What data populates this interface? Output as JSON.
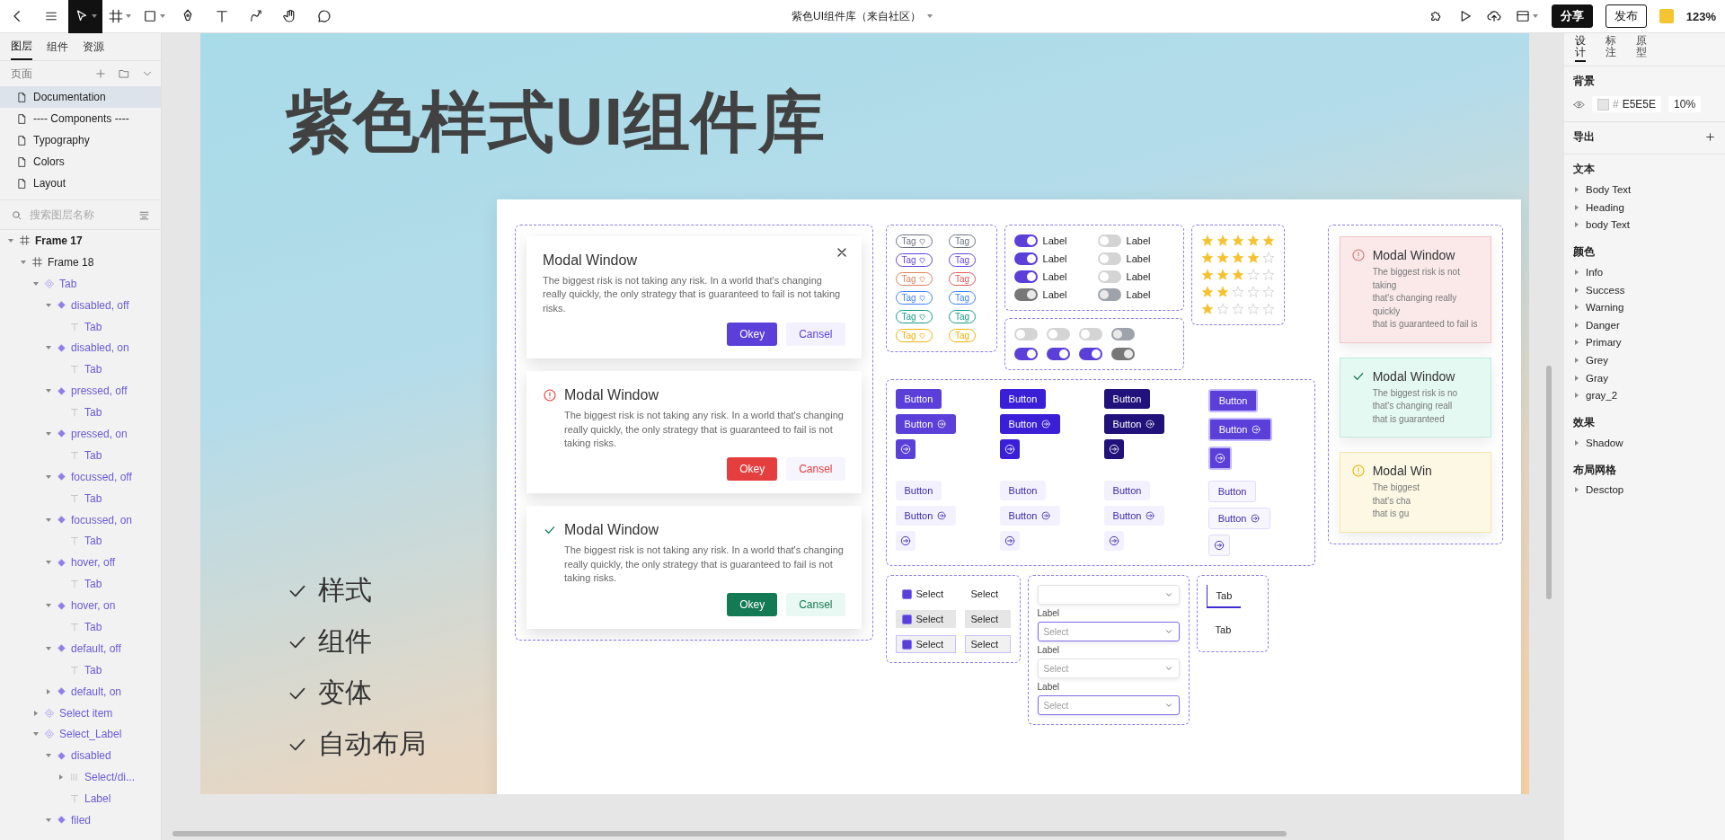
{
  "toolbar": {
    "title": "紫色UI组件库（来自社区）",
    "share": "分享",
    "publish": "发布",
    "zoom": "123%"
  },
  "left_panel": {
    "tabs": [
      {
        "label": "图层",
        "selected": true
      },
      {
        "label": "组件",
        "selected": false
      },
      {
        "label": "资源",
        "selected": false
      }
    ],
    "pages_label": "页面",
    "pages": [
      {
        "name": "Documentation",
        "selected": true
      },
      {
        "name": "---- Components ----",
        "selected": false
      },
      {
        "name": "Typography",
        "selected": false
      },
      {
        "name": "Colors",
        "selected": false
      },
      {
        "name": "Layout",
        "selected": false
      }
    ],
    "search": {
      "placeholder": "搜索图层名称"
    },
    "layers": [
      {
        "name": "Frame 17",
        "kind": "frame",
        "expanded": true,
        "children": [
          {
            "name": "Frame 18",
            "kind": "frame",
            "expanded": true,
            "children": [
              {
                "name": "Tab",
                "kind": "component",
                "expanded": true,
                "children": [
                  {
                    "name": "disabled, off",
                    "kind": "variant",
                    "expanded": true,
                    "children": [
                      {
                        "name": "Tab",
                        "kind": "text"
                      }
                    ]
                  },
                  {
                    "name": "disabled, on",
                    "kind": "variant",
                    "expanded": true,
                    "children": [
                      {
                        "name": "Tab",
                        "kind": "text"
                      }
                    ]
                  },
                  {
                    "name": "pressed, off",
                    "kind": "variant",
                    "expanded": true,
                    "children": [
                      {
                        "name": "Tab",
                        "kind": "text"
                      }
                    ]
                  },
                  {
                    "name": "pressed, on",
                    "kind": "variant",
                    "expanded": true,
                    "children": [
                      {
                        "name": "Tab",
                        "kind": "text"
                      }
                    ]
                  },
                  {
                    "name": "focussed, off",
                    "kind": "variant",
                    "expanded": true,
                    "children": [
                      {
                        "name": "Tab",
                        "kind": "text"
                      }
                    ]
                  },
                  {
                    "name": "focussed, on",
                    "kind": "variant",
                    "expanded": true,
                    "children": [
                      {
                        "name": "Tab",
                        "kind": "text"
                      }
                    ]
                  },
                  {
                    "name": "hover, off",
                    "kind": "variant",
                    "expanded": true,
                    "children": [
                      {
                        "name": "Tab",
                        "kind": "text"
                      }
                    ]
                  },
                  {
                    "name": "hover, on",
                    "kind": "variant",
                    "expanded": true,
                    "children": [
                      {
                        "name": "Tab",
                        "kind": "text"
                      }
                    ]
                  },
                  {
                    "name": "default, off",
                    "kind": "variant",
                    "expanded": true,
                    "children": [
                      {
                        "name": "Tab",
                        "kind": "text"
                      }
                    ]
                  },
                  {
                    "name": "default, on",
                    "kind": "variant",
                    "expanded": false
                  }
                ]
              },
              {
                "name": "Select item",
                "kind": "component",
                "expanded": false
              },
              {
                "name": "Select_Label",
                "kind": "component",
                "expanded": true,
                "children": [
                  {
                    "name": "disabled",
                    "kind": "variant",
                    "expanded": true,
                    "children": [
                      {
                        "name": "Select/di...",
                        "kind": "group",
                        "expanded": false
                      },
                      {
                        "name": "Label",
                        "kind": "text"
                      }
                    ]
                  },
                  {
                    "name": "filed",
                    "kind": "variant",
                    "expanded": true
                  }
                ]
              }
            ]
          }
        ]
      }
    ]
  },
  "canvas": {
    "title": "紫色样式UI组件库",
    "features": [
      "样式",
      "组件",
      "变体",
      "自动布局"
    ],
    "artboard": {
      "modals": [
        {
          "kind": "plain",
          "closable": true,
          "title": "Modal Window",
          "body": "The biggest risk is not taking any risk. In a world that's changing really quickly, the only strategy that is guaranteed to fail is not taking risks.",
          "ok": "Okey",
          "cancel": "Cansel"
        },
        {
          "kind": "danger",
          "closable": false,
          "title": "Modal Window",
          "body": "The biggest risk is not taking any risk. In a world that's changing really quickly, the only strategy that is guaranteed to fail is not taking risks.",
          "ok": "Okey",
          "cancel": "Cansel"
        },
        {
          "kind": "success",
          "closable": false,
          "title": "Modal Window",
          "body": "The biggest risk is not taking any risk. In a world that's changing really quickly, the only strategy that is guaranteed to fail is not taking risks.",
          "ok": "Okey",
          "cancel": "Cansel"
        }
      ],
      "tags": [
        {
          "label": "Tag",
          "heart": true,
          "color": "#6b7280"
        },
        {
          "label": "Tag",
          "heart": false,
          "color": "#6b7280"
        },
        {
          "label": "Tag",
          "heart": true,
          "color": "#5b45e0"
        },
        {
          "label": "Tag",
          "heart": false,
          "color": "#5b45e0"
        },
        {
          "label": "Tag",
          "heart": true,
          "color": "#d9825b"
        },
        {
          "label": "Tag",
          "heart": false,
          "color": "#e05a5a"
        },
        {
          "label": "Tag",
          "heart": true,
          "color": "#3b82f6"
        },
        {
          "label": "Tag",
          "heart": false,
          "color": "#3b82f6"
        },
        {
          "label": "Tag",
          "heart": true,
          "color": "#159a86"
        },
        {
          "label": "Tag",
          "heart": false,
          "color": "#159a86"
        },
        {
          "label": "Tag",
          "heart": true,
          "color": "#eab308"
        },
        {
          "label": "Tag",
          "heart": false,
          "color": "#eab308"
        }
      ],
      "labeled_toggles": [
        {
          "label": "Label",
          "on": true,
          "disabled": false
        },
        {
          "label": "Label",
          "on": false,
          "disabled": false
        },
        {
          "label": "Label",
          "on": true,
          "disabled": false
        },
        {
          "label": "Label",
          "on": false,
          "disabled": false
        },
        {
          "label": "Label",
          "on": true,
          "disabled": false
        },
        {
          "label": "Label",
          "on": false,
          "disabled": false
        },
        {
          "label": "Label",
          "on": true,
          "disabled": true
        },
        {
          "label": "Label",
          "on": false,
          "disabled": true
        }
      ],
      "toggles": [
        {
          "on": false,
          "disabled": false
        },
        {
          "on": false,
          "disabled": false
        },
        {
          "on": false,
          "disabled": false
        },
        {
          "on": false,
          "disabled": true
        },
        {
          "on": true,
          "disabled": false
        },
        {
          "on": true,
          "disabled": false
        },
        {
          "on": true,
          "disabled": false
        },
        {
          "on": true,
          "disabled": true
        }
      ],
      "stars": [
        {
          "stars": 5
        },
        {
          "stars": 4
        },
        {
          "stars": 3
        },
        {
          "stars": 2
        },
        {
          "stars": 1
        }
      ],
      "button_groups": [
        {
          "kind": "primary",
          "items": [
            {
              "kind": "text",
              "label": "Button"
            },
            {
              "kind": "icon_text",
              "label": "Button"
            },
            {
              "kind": "icon"
            }
          ]
        },
        {
          "kind": "bright",
          "items": [
            {
              "kind": "text",
              "label": "Button"
            },
            {
              "kind": "icon_text",
              "label": "Button"
            },
            {
              "kind": "icon"
            }
          ]
        },
        {
          "kind": "navy",
          "items": [
            {
              "kind": "text",
              "label": "Button"
            },
            {
              "kind": "icon_text",
              "label": "Button"
            },
            {
              "kind": "icon"
            }
          ]
        },
        {
          "kind": "focused",
          "items": [
            {
              "kind": "text",
              "label": "Button"
            },
            {
              "kind": "icon_text",
              "label": "Button"
            },
            {
              "kind": "icon"
            }
          ]
        },
        {
          "kind": "light",
          "items": [
            {
              "kind": "text",
              "label": "Button"
            },
            {
              "kind": "icon_text",
              "label": "Button"
            },
            {
              "kind": "icon"
            }
          ]
        },
        {
          "kind": "light",
          "items": [
            {
              "kind": "text",
              "label": "Button"
            },
            {
              "kind": "icon_text",
              "label": "Button"
            },
            {
              "kind": "icon"
            }
          ]
        },
        {
          "kind": "light",
          "items": [
            {
              "kind": "text",
              "label": "Button"
            },
            {
              "kind": "icon_text",
              "label": "Button"
            },
            {
              "kind": "icon"
            }
          ]
        },
        {
          "kind": "outline",
          "items": [
            {
              "kind": "text",
              "label": "Button"
            },
            {
              "kind": "icon_text",
              "label": "Button"
            },
            {
              "kind": "icon"
            }
          ]
        }
      ],
      "select_items": [
        {
          "kind": "checkbox",
          "label": "Select",
          "checked": true,
          "hovered": false,
          "focused": false
        },
        {
          "kind": "plain",
          "label": "Select",
          "hovered": false,
          "focused": false
        },
        {
          "kind": "checkbox",
          "label": "Select",
          "checked": true,
          "hovered": true,
          "focused": false
        },
        {
          "kind": "plain",
          "label": "Select",
          "hovered": true,
          "focused": false
        },
        {
          "kind": "checkbox",
          "label": "Select",
          "checked": true,
          "hovered": true,
          "focused": true
        },
        {
          "kind": "plain",
          "label": "Select",
          "hovered": true,
          "focused": true
        }
      ],
      "select_fields": [
        {
          "focused": false
        },
        {
          "label": "Label",
          "placeholder": "Select",
          "focused": true
        },
        {
          "label": "Label",
          "placeholder": "Select",
          "focused": false
        },
        {
          "label": "Label",
          "placeholder": "Select",
          "focused": true
        }
      ],
      "tabs": [
        {
          "label": "Tab",
          "selected": true
        },
        {
          "label": "Tab",
          "selected": false
        }
      ],
      "alerts": [
        {
          "kind": "danger",
          "title": "Modal Window",
          "body_lines": [
            "The biggest risk is not taking",
            "that's changing really quickly",
            "that is guaranteed to fail is"
          ]
        },
        {
          "kind": "success",
          "title": "Modal Window",
          "body_lines": [
            "The biggest risk is no",
            "that's changing reall",
            "that is guaranteed"
          ]
        },
        {
          "kind": "warning",
          "title": "Modal Win",
          "body_lines": [
            "The biggest",
            "that's cha",
            "that is gu"
          ]
        }
      ]
    }
  },
  "right_panel": {
    "tabs": [
      {
        "label": "设计",
        "selected": true
      },
      {
        "label": "标注",
        "selected": false
      },
      {
        "label": "原型",
        "selected": false
      }
    ],
    "background": {
      "label": "背景",
      "hex_prefix": "#",
      "hex": "E5E5E",
      "opacity": "10%"
    },
    "export_label": "导出",
    "sections": [
      {
        "title": "文本",
        "items": [
          "Body Text",
          "Heading",
          "body Text"
        ]
      },
      {
        "title": "颜色",
        "items": [
          "Info",
          "Success",
          "Warning",
          "Danger",
          "Primary",
          "Grey",
          "Gray",
          "gray_2"
        ]
      },
      {
        "title": "效果",
        "items": [
          "Shadow"
        ]
      },
      {
        "title": "布局网格",
        "items": [
          "Desctop"
        ]
      }
    ]
  }
}
